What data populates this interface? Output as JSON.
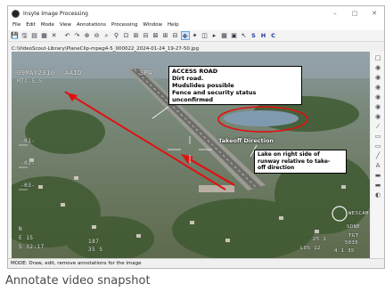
{
  "window": {
    "title": "Insyte Image Processing",
    "controls": [
      "–",
      "□",
      "✕"
    ]
  },
  "menu": [
    "File",
    "Edit",
    "Mode",
    "View",
    "Annotations",
    "Processing",
    "Window",
    "Help"
  ],
  "toolbar": {
    "icons": [
      "💾",
      "🖫",
      "▤",
      "▦",
      "✕",
      "↶",
      "↷",
      "⊕",
      "⊖",
      "⌕",
      "⚲",
      "⊡",
      "⊞",
      "⊟",
      "⊠",
      "⊞",
      "⊟",
      "✥",
      "✦",
      "◫",
      "▸",
      "▦",
      "▣",
      "↖"
    ],
    "letters": [
      "S",
      "H",
      "C"
    ]
  },
  "file_path": "C:\\VideoScout-Library\\PlaneClip-mpeg4-5_000022_2024-01-24_19-27-50.jpg",
  "osd": {
    "date": "09MAY2010",
    "code": "AAID",
    "mode": "SPA",
    "sub": "MTC-5.5",
    "n1": "-01-",
    "n2": "-02-",
    "n3": "-03-",
    "wescam": "WESCAM",
    "bottom_left1": "N",
    "bottom_left2": "E 15",
    "bottom_left3": "S 32:17",
    "bottom_mid1": "187",
    "bottom_mid2": "35 S",
    "bottom_right1": "SONE",
    "bottom_right2": "25 1",
    "bottom_right3": "LOS 12",
    "bottom_right4": "TGT",
    "bottom_right5": "5035",
    "bottom_right6": "4 1 35"
  },
  "annotations": {
    "access_title": "ACCESS ROAD",
    "access_line1": "Dirt road.",
    "access_line2": "Mudslides possible",
    "access_line3": "Fence and security status unconfirmed",
    "takeoff": "Takeoff Direction",
    "lake_line1": "Lake on right side of",
    "lake_line2": "runway relative to take-",
    "lake_line3": "off direction"
  },
  "side_icons": [
    "□",
    "◉",
    "◉",
    "◉",
    "◉",
    "◉",
    "◉",
    "⁄",
    "▭",
    "▭",
    "╱",
    "A",
    "▬",
    "▬",
    "◐"
  ],
  "status": "MODE:  Draw, edit, remove annotations for the image",
  "caption": "Annotate video snapshot",
  "colors": {
    "annotation": "#e01010",
    "accent": "#1a3a9a"
  }
}
